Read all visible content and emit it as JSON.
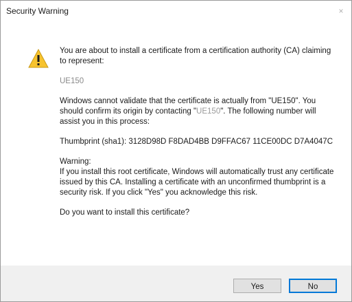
{
  "window": {
    "title": "Security Warning",
    "close_glyph": "×"
  },
  "message": {
    "intro": "You are about to install a certificate from a certification authority (CA) claiming to represent:",
    "ca_name": "UE150",
    "validate_part1": "Windows cannot validate that the certificate is actually from \"UE150\". You should confirm its origin by contacting \"",
    "validate_redacted": "UE150",
    "validate_part2": "\". The following number will assist you in this process:",
    "thumbprint": "Thumbprint (sha1): 3128D98D F8DAD4BB D9FFAC67 11CE00DC D7A4047C",
    "warning_heading": "Warning:",
    "warning_body": "If you install this root certificate, Windows will automatically trust any certificate issued by this CA. Installing a certificate with an unconfirmed thumbprint is a security risk. If you click \"Yes\" you acknowledge this risk.",
    "question": "Do you want to install this certificate?"
  },
  "buttons": {
    "yes": "Yes",
    "no": "No"
  },
  "icons": {
    "warning": "warning-triangle-icon",
    "close": "close-icon"
  },
  "colors": {
    "warning_fill": "#f7c32e",
    "focus_border": "#0078d7",
    "footer_bg": "#f0f0f0"
  }
}
